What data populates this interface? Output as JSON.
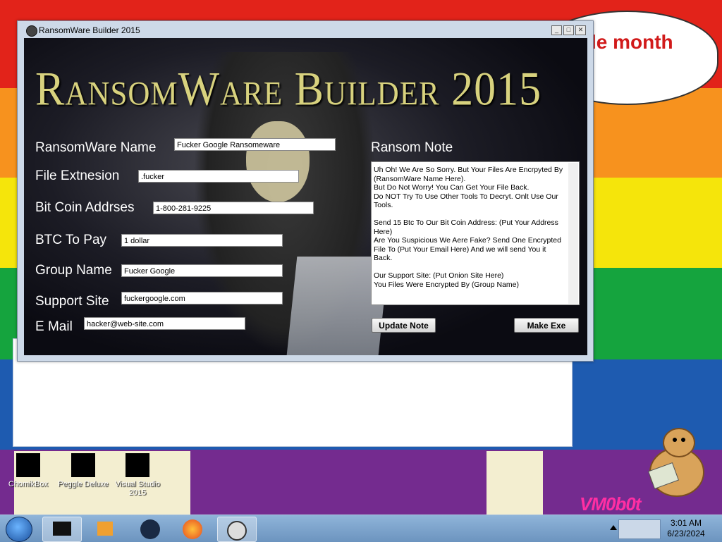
{
  "window": {
    "title": "RansomWare Builder 2015",
    "banner": "RansomWare Builder 2015"
  },
  "form": {
    "ransomware_name_label": "RansomWare Name",
    "ransomware_name_value": "Fucker Google Ransomeware",
    "file_extension_label": "File Extnesion",
    "file_extension_value": ".fucker",
    "bitcoin_address_label": "Bit Coin Addrses",
    "bitcoin_address_value": "1-800-281-9225",
    "btc_to_pay_label": "BTC To Pay",
    "btc_to_pay_value": "1 dollar",
    "group_name_label": "Group Name",
    "group_name_value": "Fucker Google",
    "support_site_label": "Support Site",
    "support_site_value": "fuckergoogle.com",
    "email_label": "E Mail",
    "email_value": "hacker@web-site.com"
  },
  "ransom_note": {
    "label": "Ransom Note",
    "lines": [
      "Uh Oh! We Are So Sorry. But Your Files Are Encrpyted By (RansomWare Name Here).",
      "But Do Not Worry! You Can Get Your File Back.",
      "Do NOT Try To Use Other Tools To Decryt. Onlt Use Our Tools.",
      "",
      "Send 15 Btc To Our Bit Coin Address: (Put Your Address Here)",
      "Are You Suspicious We Aere Fake? Send One Encrypted File To (Put Your Email Here) And we will send You it Back.",
      "",
      "Our Support Site: (Put Onion Site Here)",
      "You Files Were Encrypted By (Group Name)"
    ]
  },
  "buttons": {
    "update_note": "Update Note",
    "make_exe": "Make Exe"
  },
  "desktop": {
    "speech_text": "le month",
    "watermark": "VM0b0t",
    "icons": [
      "ChomikBox",
      "Peggle Deluxe",
      "Visual Studio 2015"
    ]
  },
  "taskbar": {
    "time": "3:01 AM",
    "date": "6/23/2024"
  },
  "colors": {
    "banner_gold": "#d8d27e",
    "speech_red": "#d11a1a"
  }
}
